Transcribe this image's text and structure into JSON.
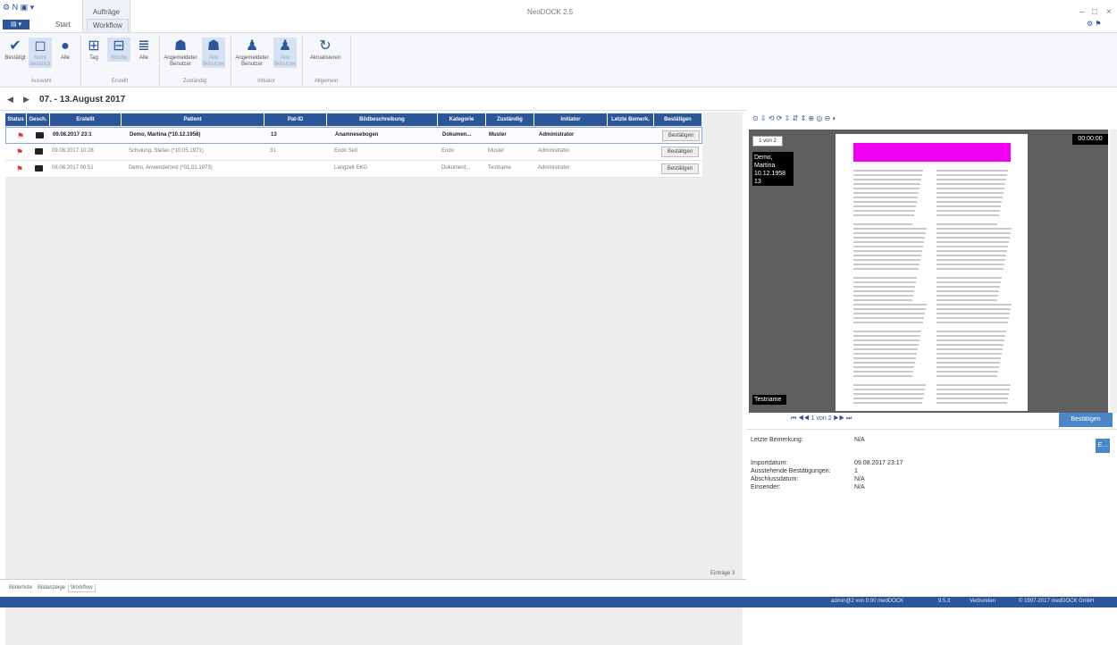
{
  "window": {
    "title": "NeoDOCK 2.5",
    "min": "–",
    "max": "□",
    "close": "×",
    "right_icons": "⚙ ⚑"
  },
  "quick_access": {
    "icons": "⚙ N ▣ ▾"
  },
  "ribbon": {
    "app_menu": "▤ ▾",
    "context_tab": "Aufträge",
    "tabs": [
      "Start",
      "Workflow"
    ],
    "buttons": [
      {
        "label": "Bestätigt",
        "icon": "check-stamp-icon"
      },
      {
        "label": "Nicht bestätigt",
        "icon": "uncheck-stamp-icon"
      },
      {
        "label": "Alle",
        "icon": "all-stamp-icon"
      },
      {
        "label": "Tag",
        "icon": "day-icon"
      },
      {
        "label": "Woche",
        "icon": "week-icon"
      },
      {
        "label": "Alle",
        "icon": "all-time-icon"
      },
      {
        "label": "Angemeldeter Benutzer",
        "icon": "user-group-icon"
      },
      {
        "label": "Alle Benutzer",
        "icon": "all-users-icon"
      },
      {
        "label": "Angemeldeter Benutzer",
        "icon": "user-icon"
      },
      {
        "label": "Alle Benutzer",
        "icon": "all-users2-icon"
      },
      {
        "label": "Aktualisieren",
        "icon": "refresh-icon"
      }
    ],
    "groups": [
      "Auswahl",
      "Erstellt",
      "Zuständig",
      "Initiator",
      "Allgemein"
    ]
  },
  "date_nav": {
    "title": "07. - 13.August 2017"
  },
  "table": {
    "headers": [
      "Status",
      "Gesch.",
      "Erstellt",
      "Patient",
      "Pat-ID",
      "Bildbeschreibung",
      "Kategorie",
      "Zuständig",
      "Initiator",
      "Letzte Bemerk.",
      "Bestätigen"
    ],
    "rows": [
      {
        "created": "09.08.2017 23:1",
        "patient": "Demo, Martina (*10.12.1958)",
        "pat_id": "13",
        "desc": "Anamnesebogen",
        "cat": "Dokumen...",
        "resp": "Muster",
        "init": "Administrator",
        "confirm": "Bestätigen"
      },
      {
        "created": "09.08.2017 10:28",
        "patient": "Schulung, Stefan (*10.05.1971)",
        "pat_id": "31",
        "desc": "Endo Seit",
        "cat": "Endo",
        "resp": "Muster",
        "init": "Administrator",
        "confirm": "Bestätigen"
      },
      {
        "created": "08.08.2017 00:51",
        "patient": "Demo, Anwendertest (*01.01.1973)",
        "pat_id": "",
        "desc": "Langzeit EKG",
        "cat": "Dokument...",
        "resp": "Testname",
        "init": "Administrator",
        "confirm": "Bestätigen"
      }
    ],
    "entries": "Einträge 3"
  },
  "bottom_tabs": [
    "Bilderliste",
    "Bildanzeige",
    "Workflow"
  ],
  "preview": {
    "page_badge": "1 von 2",
    "patient": [
      "Demo, Martina",
      "10.12.1958",
      "13"
    ],
    "timecode": "00:00:00",
    "author": "Testname",
    "pager": "⏮ ◀◀ 1 von 2 ▶▶ ⏭",
    "confirm": "Bestätigen",
    "toolbar_icons": "⊙ ⇩ ⟲ ⟳ ⇳ ⇵ ⇕ ⊕ ◎ ⊖ ◐"
  },
  "details": {
    "last_remark_label": "Letzte Bemerkung:",
    "last_remark": "N/A",
    "import_label": "Importdatum:",
    "import": "09.08.2017 23:17",
    "pending_label": "Ausstehende Bestätigungen:",
    "pending": "1",
    "closed_label": "Abschlussdatum:",
    "closed": "N/A",
    "by_label": "Einsender:",
    "by": "N/A",
    "edit": "E..."
  },
  "status": {
    "user": "admin@2 von 0:00 medDOCK",
    "version": "9.5.3",
    "connected": "Verbunden",
    "copyright": "© 1997-2017 medDOCK GmbH"
  }
}
